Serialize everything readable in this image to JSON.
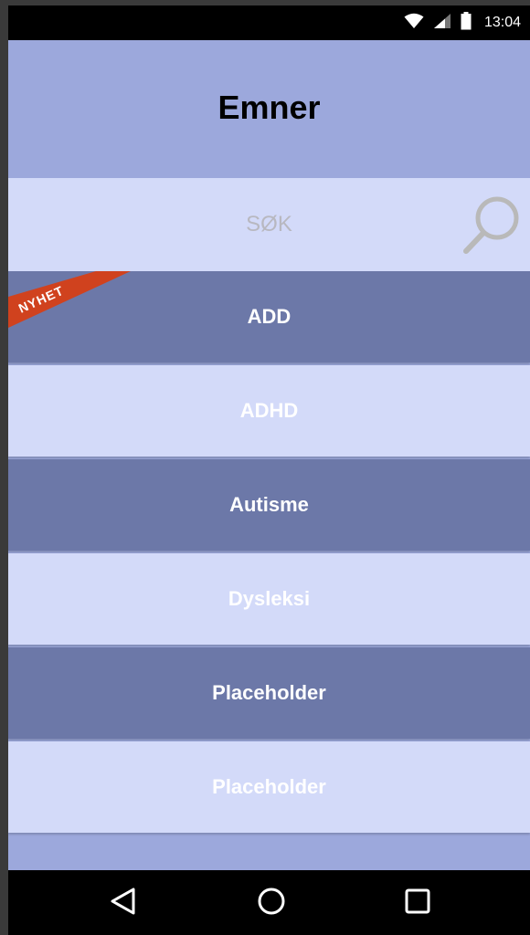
{
  "status_bar": {
    "time": "13:04",
    "icons": [
      "wifi-icon",
      "cellular-signal-icon",
      "battery-icon"
    ]
  },
  "header": {
    "title": "Emner"
  },
  "search": {
    "placeholder": "SØK",
    "icon": "search-icon"
  },
  "topics": [
    {
      "label": "ADD",
      "style": "dark",
      "badge": "NYHET"
    },
    {
      "label": "ADHD",
      "style": "light"
    },
    {
      "label": "Autisme",
      "style": "dark"
    },
    {
      "label": "Dysleksi",
      "style": "light"
    },
    {
      "label": "Placeholder",
      "style": "dark"
    },
    {
      "label": "Placeholder",
      "style": "light"
    }
  ],
  "navigation": {
    "buttons": [
      "back-icon",
      "home-icon",
      "recents-icon"
    ]
  },
  "colors": {
    "header_bg": "#9ca8dc",
    "row_dark": "#6c78a8",
    "row_light": "#d3daf9",
    "badge": "#d0421e"
  }
}
